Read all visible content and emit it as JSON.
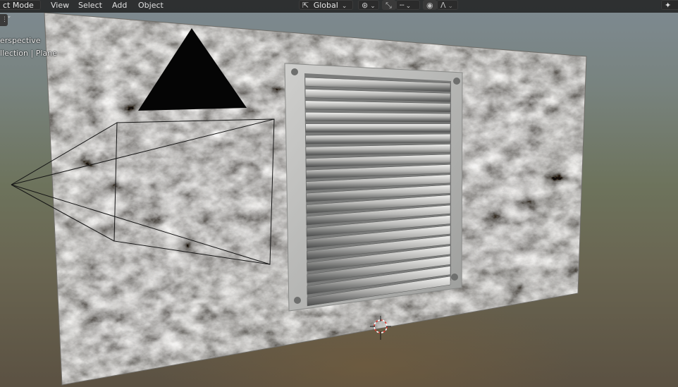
{
  "header": {
    "mode_label": "ct Mode",
    "menus": [
      "View",
      "Select",
      "Add",
      "Object"
    ],
    "orientation_label": "Global"
  },
  "overlay": {
    "view_name": "erspective",
    "collection_path": "llection | Plane"
  },
  "icons": {
    "mode_dropdown": "chevron-down-icon",
    "orientation": "transform-orientation-icon",
    "pivot": "pivot-point-icon",
    "snap": "snap-magnet-icon",
    "snap_target": "snap-increment-icon",
    "proportional": "proportional-editing-icon",
    "falloff": "falloff-curve-icon",
    "gizmo": "navigation-gizmo-icon",
    "cursor": "3d-cursor-icon"
  },
  "colors": {
    "header_bg": "#1c1c1c",
    "wall": "#8c8a85",
    "vent": "#c2c2c0",
    "cursor_red": "#d93a32"
  }
}
